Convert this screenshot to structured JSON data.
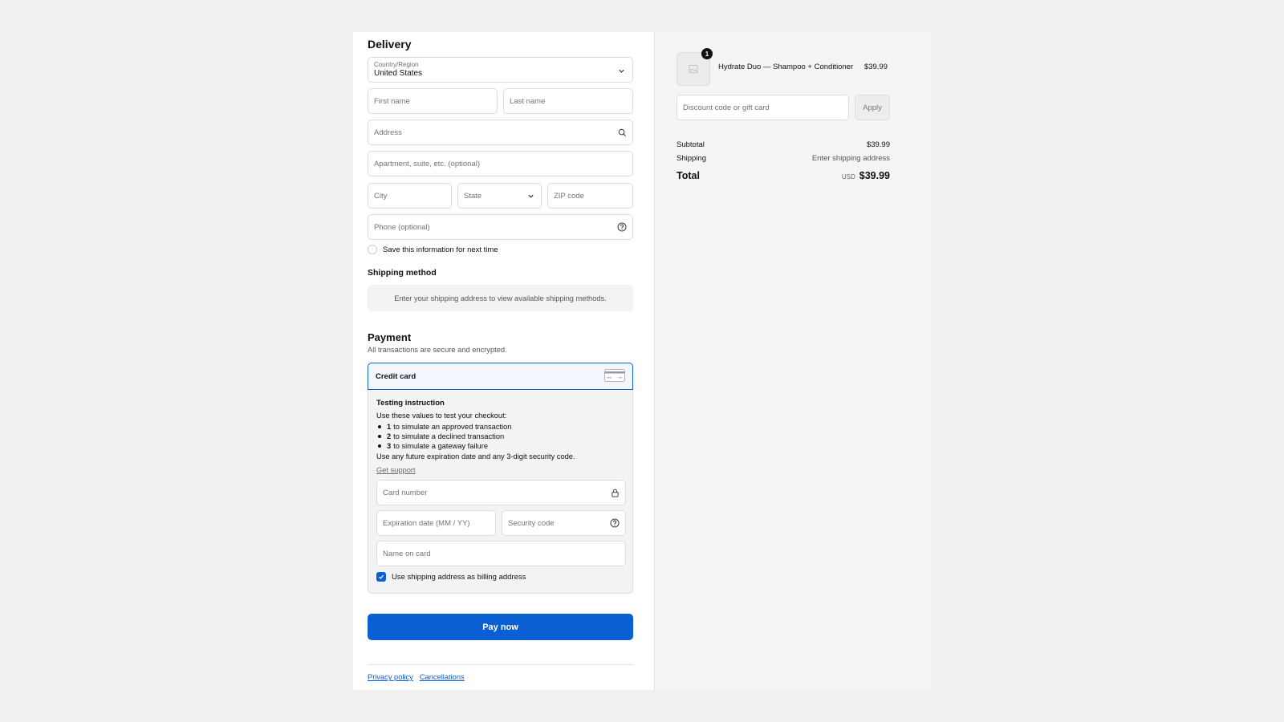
{
  "delivery": {
    "title": "Delivery",
    "country_label": "Country/Region",
    "country_value": "United States",
    "first_name_placeholder": "First name",
    "last_name_placeholder": "Last name",
    "address_placeholder": "Address",
    "apartment_placeholder": "Apartment, suite, etc. (optional)",
    "city_placeholder": "City",
    "state_placeholder": "State",
    "zip_placeholder": "ZIP code",
    "phone_placeholder": "Phone (optional)",
    "save_info_label": "Save this information for next time",
    "save_info_checked": false
  },
  "shipping_method": {
    "title": "Shipping method",
    "notice": "Enter your shipping address to view available shipping methods."
  },
  "payment": {
    "title": "Payment",
    "subtitle": "All transactions are secure and encrypted.",
    "method_label": "Credit card",
    "testing": {
      "title": "Testing instruction",
      "intro": "Use these values to test your checkout:",
      "items": [
        {
          "code": "1",
          "text": "to simulate an approved transaction"
        },
        {
          "code": "2",
          "text": "to simulate a declined transaction"
        },
        {
          "code": "3",
          "text": "to simulate a gateway failure"
        }
      ],
      "outro": "Use any future expiration date and any 3-digit security code.",
      "support_link": "Get support"
    },
    "card_number_placeholder": "Card number",
    "expiration_placeholder": "Expiration date (MM / YY)",
    "security_code_placeholder": "Security code",
    "name_on_card_placeholder": "Name on card",
    "billing_same_label": "Use shipping address as billing address",
    "billing_same_checked": true,
    "pay_button": "Pay now"
  },
  "footer": {
    "links": [
      "Privacy policy",
      "Cancellations"
    ]
  },
  "summary": {
    "item": {
      "quantity": "1",
      "name": "Hydrate Duo — Shampoo + Conditioner",
      "price": "$39.99"
    },
    "discount_placeholder": "Discount code or gift card",
    "apply_label": "Apply",
    "subtotal_label": "Subtotal",
    "subtotal_value": "$39.99",
    "shipping_label": "Shipping",
    "shipping_value": "Enter shipping address",
    "total_label": "Total",
    "currency": "USD",
    "total_value": "$39.99"
  },
  "colors": {
    "accent": "#0a5fd3",
    "page_bg": "#f1f1f1",
    "summary_bg": "#f5f5f5"
  }
}
